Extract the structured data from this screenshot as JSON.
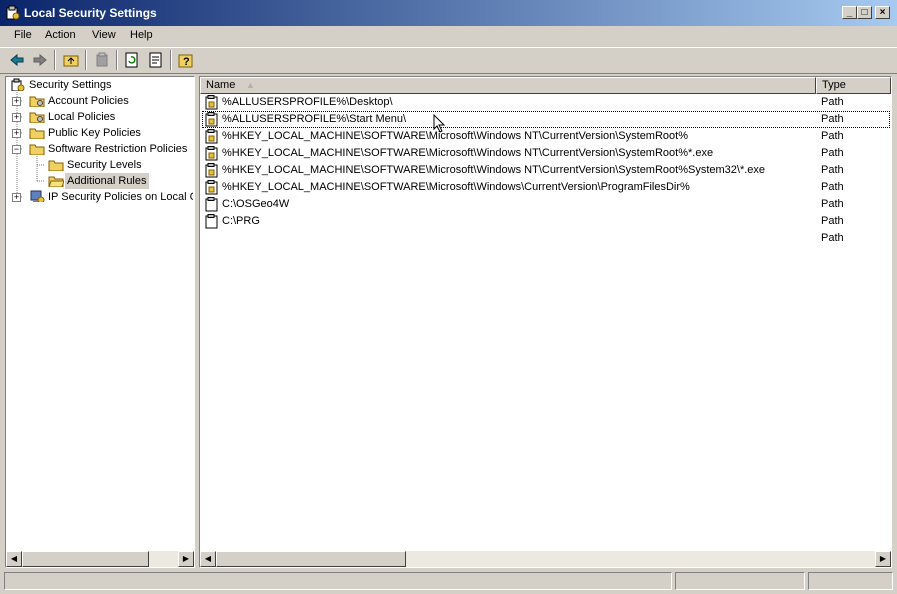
{
  "window": {
    "title": "Local Security Settings",
    "minimize": "_",
    "maximize": "□",
    "close": "×"
  },
  "menu": [
    "File",
    "Action",
    "View",
    "Help"
  ],
  "toolbar": [
    "back-icon",
    "forward-icon",
    "up-folder-icon",
    "delete-icon",
    "refresh-icon",
    "export-list-icon",
    "help-icon"
  ],
  "tree": {
    "root": "Security Settings",
    "items": [
      {
        "label": "Account Policies",
        "expander": "+"
      },
      {
        "label": "Local Policies",
        "expander": "+"
      },
      {
        "label": "Public Key Policies",
        "expander": "+"
      },
      {
        "label": "Software Restriction Policies",
        "expander": "−"
      },
      {
        "label": "Security Levels"
      },
      {
        "label": "Additional Rules",
        "selected": true
      },
      {
        "label": "IP Security Policies on Local Co",
        "expander": "+"
      }
    ]
  },
  "list": {
    "columns": [
      "Name",
      "Type"
    ],
    "sort_indicator": "▲",
    "rows": [
      {
        "name": "%ALLUSERSPROFILE%\\Desktop\\",
        "type": "Path"
      },
      {
        "name": "%ALLUSERSPROFILE%\\Start Menu\\",
        "type": "Path"
      },
      {
        "name": "%HKEY_LOCAL_MACHINE\\SOFTWARE\\Microsoft\\Windows NT\\CurrentVersion\\SystemRoot%",
        "type": "Path"
      },
      {
        "name": "%HKEY_LOCAL_MACHINE\\SOFTWARE\\Microsoft\\Windows NT\\CurrentVersion\\SystemRoot%*.exe",
        "type": "Path"
      },
      {
        "name": "%HKEY_LOCAL_MACHINE\\SOFTWARE\\Microsoft\\Windows NT\\CurrentVersion\\SystemRoot%System32\\*.exe",
        "type": "Path"
      },
      {
        "name": "%HKEY_LOCAL_MACHINE\\SOFTWARE\\Microsoft\\Windows\\CurrentVersion\\ProgramFilesDir%",
        "type": "Path"
      },
      {
        "name": "C:\\OSGeo4W",
        "type": "Path"
      },
      {
        "name": "C:\\PRG",
        "type": "Path"
      },
      {
        "name": "",
        "type": "Path"
      }
    ]
  },
  "colors": {
    "titlebar_start": "#0a246a",
    "titlebar_end": "#a6caf0",
    "face": "#d4d0c8",
    "folder": "#f0d060"
  }
}
